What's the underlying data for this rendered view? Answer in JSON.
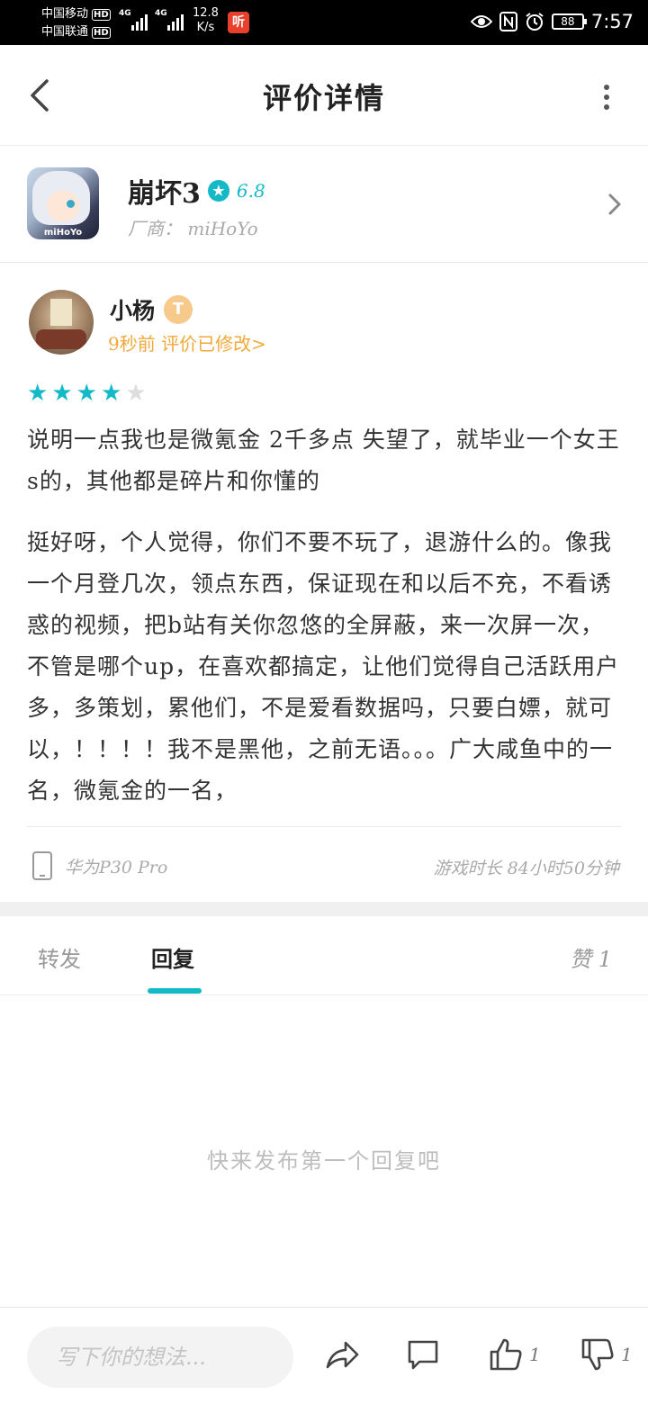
{
  "status_bar": {
    "carrier1": "中国移动",
    "carrier2": "中国联通",
    "hd": "HD",
    "net1": "4G",
    "net2": "4G",
    "speed_value": "12.8",
    "speed_unit": "K/s",
    "app_badge": "听",
    "battery": "88",
    "time": "7:57"
  },
  "header": {
    "title": "评价详情"
  },
  "game": {
    "name": "崩坏3",
    "score": "6.8",
    "vendor": "厂商： miHoYo",
    "icon_brand": "miHoYo"
  },
  "review": {
    "user_name": "小杨",
    "user_badge": "T",
    "meta": "9秒前 评价已修改>",
    "rating": 4,
    "rating_max": 5,
    "paragraph1": "说明一点我也是微氪金 2千多点 失望了，就毕业一个女王s的，其他都是碎片和你懂的",
    "paragraph2": "挺好呀，个人觉得，你们不要不玩了，退游什么的。像我一个月登几次，领点东西，保证现在和以后不充，不看诱惑的视频，把b站有关你忽悠的全屏蔽，来一次屏一次，不管是哪个up，在喜欢都搞定，让他们觉得自己活跃用户多，多策划，累他们，不是爱看数据吗，只要白嫖，就可以，！！！！我不是黑他，之前无语。。。广大咸鱼中的一名，微氪金的一名，",
    "device": "华为P30 Pro",
    "playtime": "游戏时长 84小时50分钟"
  },
  "tabs": {
    "forward": "转发",
    "reply": "回复",
    "like": "赞 1"
  },
  "empty_text": "快来发布第一个回复吧",
  "bottom": {
    "input_placeholder": "写下你的想法...",
    "like_count": "1",
    "dislike_count": "1"
  },
  "colors": {
    "accent": "#14b9c8",
    "meta_orange": "#f0a93a"
  }
}
